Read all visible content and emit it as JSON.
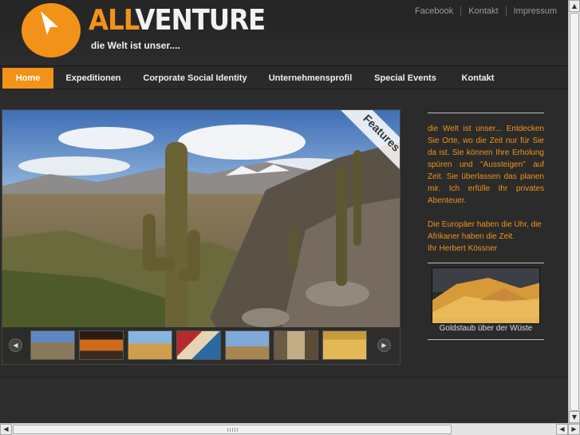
{
  "brand": {
    "logo_part1": "ALL",
    "logo_part2": "VENTURE",
    "tagline": "die Welt ist unser....",
    "accent_color": "#f39218"
  },
  "top_links": [
    "Facebook",
    "Kontakt",
    "Impressum"
  ],
  "nav": {
    "items": [
      "Home",
      "Expeditionen",
      "Corporate Social Identity",
      "Unternehmensprofil",
      "Special Events",
      "Kontakt"
    ],
    "active_index": 0
  },
  "slider": {
    "badge": "Features",
    "prev_icon": "chevron-left-icon",
    "next_icon": "chevron-right-icon"
  },
  "intro": {
    "paragraph1": "die Welt ist unser... Entdecken Sie Orte, wo die Zeit nur für Sie da ist. Sie können Ihre Erholung spüren und \"Aussteigen\" auf Zeit. Sie überlassen das planen mir. Ich erfülle Ihr privates Abenteuer.",
    "paragraph2_line1": "Die Europäer haben die Uhr, die Afrikaner haben die Zeit.",
    "paragraph2_line2": "Ihr Herbert Kössner"
  },
  "promo": {
    "caption": "Goldstaub über der Wüste"
  }
}
